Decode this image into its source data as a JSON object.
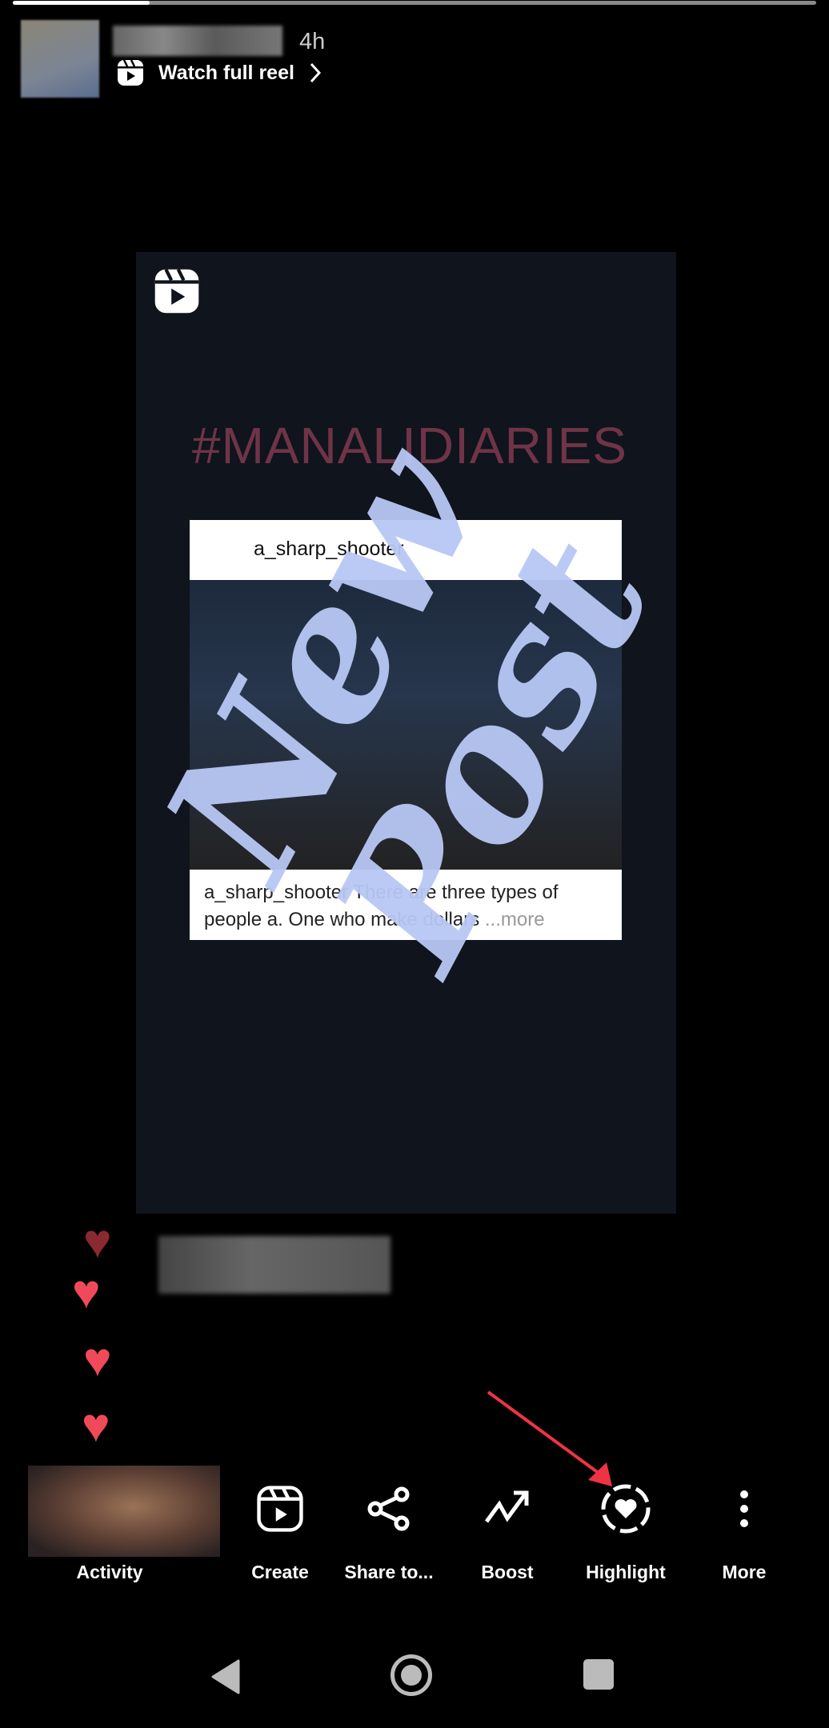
{
  "header": {
    "progress": 0.17,
    "time": "4h",
    "watch_label": "Watch full reel"
  },
  "reel": {
    "hashtag": "#MANALIDIARIES",
    "username": "a_sharp_shooter",
    "caption_user": "a_sharp_shooter",
    "caption_text": " There are three types of people a. One who make dollars",
    "more": "...more",
    "overlay_text": "New Post"
  },
  "actions": [
    {
      "label": "Activity"
    },
    {
      "label": "Create",
      "icon": "reel-icon"
    },
    {
      "label": "Share to...",
      "icon": "share-icon"
    },
    {
      "label": "Boost",
      "icon": "trend-up-icon"
    },
    {
      "label": "Highlight",
      "icon": "highlight-heart-icon"
    },
    {
      "label": "More",
      "icon": "more-vertical-icon"
    }
  ],
  "colors": {
    "heart": "#f04a5a",
    "arrow": "#ee3444",
    "overlay": "#b8c8f5"
  }
}
